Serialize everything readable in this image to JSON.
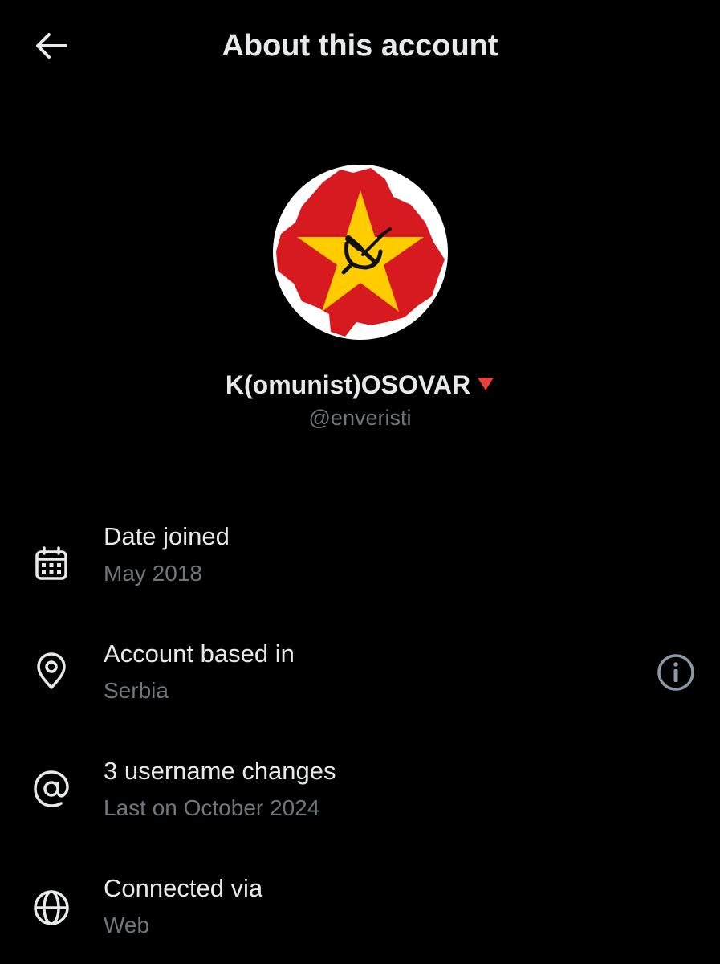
{
  "header": {
    "title": "About this account",
    "back_icon": "arrow-left-icon"
  },
  "profile": {
    "display_name": "K(omunist)OSOVAR",
    "name_emoji": "red-triangle-down-icon",
    "handle": "@enveristi",
    "avatar": "kosovo-map-star-hammer-sickle-avatar"
  },
  "rows": [
    {
      "icon": "calendar-icon",
      "title": "Date joined",
      "subtitle": "May 2018"
    },
    {
      "icon": "location-pin-icon",
      "title": "Account based in",
      "subtitle": "Serbia",
      "action_icon": "info-icon"
    },
    {
      "icon": "at-sign-icon",
      "title": "3 username changes",
      "subtitle": "Last on October 2024"
    },
    {
      "icon": "globe-icon",
      "title": "Connected via",
      "subtitle": "Web"
    }
  ],
  "colors": {
    "background": "#000000",
    "primary_text": "#e7e9ea",
    "secondary_text": "#71767b",
    "avatar_red": "#d71920",
    "avatar_yellow": "#ffcc00"
  }
}
